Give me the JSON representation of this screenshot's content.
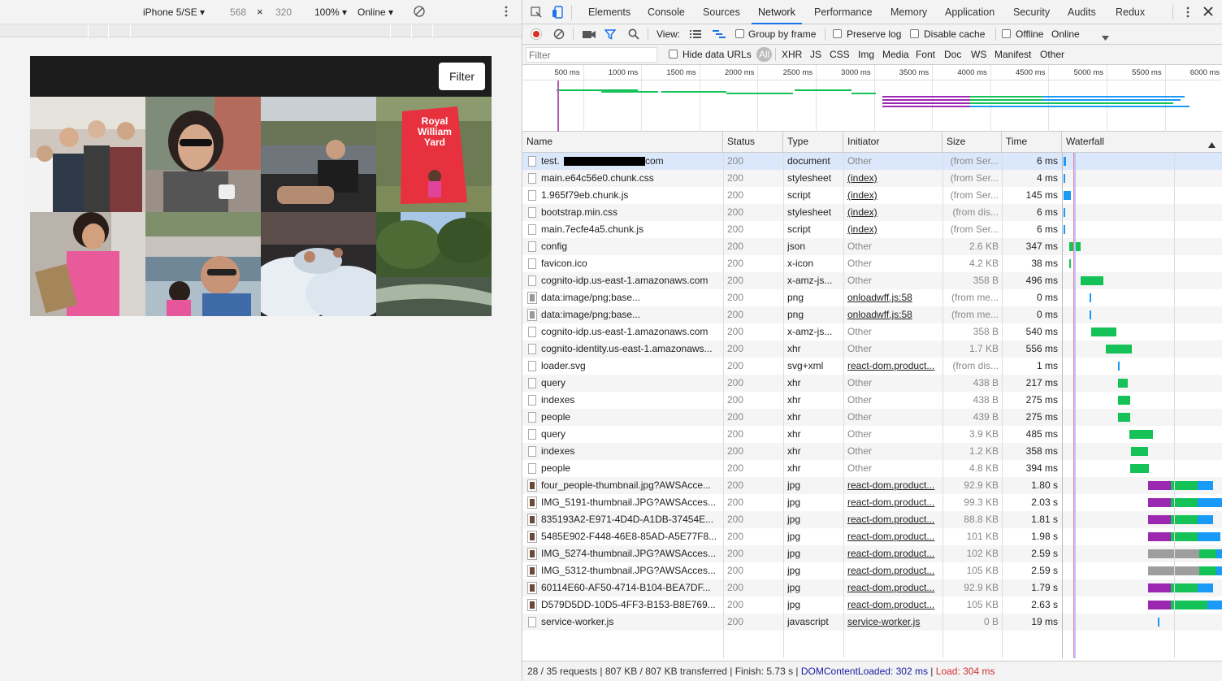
{
  "device_toolbar": {
    "device": "iPhone 5/SE ▾",
    "width": "568",
    "times": "×",
    "height": "320",
    "zoom": "100% ▾",
    "throttle": "Online ▾"
  },
  "app": {
    "filter_label": "Filter",
    "royal_sign": "Royal William Yard"
  },
  "devtools": {
    "tabs": [
      "Elements",
      "Console",
      "Sources",
      "Network",
      "Performance",
      "Memory",
      "Application",
      "Security",
      "Audits",
      "Redux"
    ],
    "active_tab": "Network",
    "toolbar": {
      "view_label": "View:",
      "group_by_frame": "Group by frame",
      "preserve_log": "Preserve log",
      "disable_cache": "Disable cache",
      "offline": "Offline",
      "online": "Online"
    },
    "filter": {
      "placeholder": "Filter",
      "hide_data_urls": "Hide data URLs",
      "types": [
        "All",
        "XHR",
        "JS",
        "CSS",
        "Img",
        "Media",
        "Font",
        "Doc",
        "WS",
        "Manifest",
        "Other"
      ]
    },
    "overview_ticks": [
      "500 ms",
      "1000 ms",
      "1500 ms",
      "2000 ms",
      "2500 ms",
      "3000 ms",
      "3500 ms",
      "4000 ms",
      "4500 ms",
      "5000 ms",
      "5500 ms",
      "6000 ms"
    ],
    "columns": [
      "Name",
      "Status",
      "Type",
      "Initiator",
      "Size",
      "Time",
      "Waterfall"
    ],
    "rows": [
      {
        "name": "test.",
        "name_suffix": "com",
        "status": "200",
        "type": "document",
        "initiator": "Other",
        "size": "(from Ser...",
        "time": "6 ms",
        "wf": [
          [
            0.0,
            0.8,
            "#1a9af7"
          ]
        ]
      },
      {
        "name": "main.e64c56e0.chunk.css",
        "status": "200",
        "type": "stylesheet",
        "initiator": "(index)",
        "size": "(from Ser...",
        "time": "4 ms",
        "wf": [
          [
            0.0,
            0.6,
            "#1a9af7"
          ]
        ]
      },
      {
        "name": "1.965f79eb.chunk.js",
        "status": "200",
        "type": "script",
        "initiator": "(index)",
        "size": "(from Ser...",
        "time": "145 ms",
        "wf": [
          [
            0.0,
            2.8,
            "#1a9af7"
          ]
        ]
      },
      {
        "name": "bootstrap.min.css",
        "status": "200",
        "type": "stylesheet",
        "initiator": "(index)",
        "size": "(from dis...",
        "time": "6 ms",
        "wf": [
          [
            0.0,
            0.6,
            "#1a9af7"
          ]
        ]
      },
      {
        "name": "main.7ecfe4a5.chunk.js",
        "status": "200",
        "type": "script",
        "initiator": "(index)",
        "size": "(from Ser...",
        "time": "6 ms",
        "wf": [
          [
            0.0,
            0.6,
            "#1a9af7"
          ]
        ]
      },
      {
        "name": "config",
        "status": "200",
        "type": "json",
        "initiator": "Other",
        "size": "2.6 KB",
        "time": "347 ms",
        "wf": [
          [
            2.1,
            6.4,
            "#14c257"
          ]
        ]
      },
      {
        "name": "favicon.ico",
        "status": "200",
        "type": "x-icon",
        "initiator": "Other",
        "size": "4.2 KB",
        "time": "38 ms",
        "wf": [
          [
            2.0,
            2.7,
            "#14c257"
          ]
        ]
      },
      {
        "name": "cognito-idp.us-east-1.amazonaws.com",
        "status": "200",
        "type": "x-amz-js...",
        "initiator": "Other",
        "size": "358 B",
        "time": "496 ms",
        "wf": [
          [
            6.4,
            15.0,
            "#14c257"
          ]
        ]
      },
      {
        "name": "data:image/png;base...",
        "status": "200",
        "type": "png",
        "initiator": "onloadwff.js:58",
        "size": "(from me...",
        "time": "0 ms",
        "wf": [
          [
            9.7,
            10.3,
            "#1a9af7"
          ]
        ]
      },
      {
        "name": "data:image/png;base...",
        "status": "200",
        "type": "png",
        "initiator": "onloadwff.js:58",
        "size": "(from me...",
        "time": "0 ms",
        "wf": [
          [
            9.7,
            10.3,
            "#1a9af7"
          ]
        ]
      },
      {
        "name": "cognito-idp.us-east-1.amazonaws.com",
        "status": "200",
        "type": "x-amz-js...",
        "initiator": "Other",
        "size": "358 B",
        "time": "540 ms",
        "wf": [
          [
            10.2,
            19.7,
            "#14c257"
          ]
        ]
      },
      {
        "name": "cognito-identity.us-east-1.amazonaws...",
        "status": "200",
        "type": "xhr",
        "initiator": "Other",
        "size": "1.7 KB",
        "time": "556 ms",
        "wf": [
          [
            15.7,
            25.5,
            "#14c257"
          ]
        ]
      },
      {
        "name": "loader.svg",
        "status": "200",
        "type": "svg+xml",
        "initiator": "react-dom.product...",
        "size": "(from dis...",
        "time": "1 ms",
        "wf": [
          [
            20.2,
            20.8,
            "#1a9af7"
          ]
        ]
      },
      {
        "name": "query",
        "status": "200",
        "type": "xhr",
        "initiator": "Other",
        "size": "438 B",
        "time": "217 ms",
        "wf": [
          [
            20.3,
            24.0,
            "#14c257"
          ]
        ]
      },
      {
        "name": "indexes",
        "status": "200",
        "type": "xhr",
        "initiator": "Other",
        "size": "438 B",
        "time": "275 ms",
        "wf": [
          [
            20.3,
            25.0,
            "#14c257"
          ]
        ]
      },
      {
        "name": "people",
        "status": "200",
        "type": "xhr",
        "initiator": "Other",
        "size": "439 B",
        "time": "275 ms",
        "wf": [
          [
            20.3,
            25.0,
            "#14c257"
          ]
        ]
      },
      {
        "name": "query",
        "status": "200",
        "type": "xhr",
        "initiator": "Other",
        "size": "3.9 KB",
        "time": "485 ms",
        "wf": [
          [
            24.5,
            33.3,
            "#14c257"
          ]
        ]
      },
      {
        "name": "indexes",
        "status": "200",
        "type": "xhr",
        "initiator": "Other",
        "size": "1.2 KB",
        "time": "358 ms",
        "wf": [
          [
            25.0,
            31.4,
            "#14c257"
          ]
        ]
      },
      {
        "name": "people",
        "status": "200",
        "type": "xhr",
        "initiator": "Other",
        "size": "4.8 KB",
        "time": "394 ms",
        "wf": [
          [
            24.8,
            31.8,
            "#14c257"
          ]
        ]
      },
      {
        "name": "four_people-thumbnail.jpg?AWSAcce...",
        "status": "200",
        "type": "jpg",
        "initiator": "react-dom.product...",
        "size": "92.9 KB",
        "time": "1.80 s",
        "wf": [
          [
            31.6,
            40.0,
            "#9c27b0"
          ],
          [
            40.0,
            50.0,
            "#14c257"
          ],
          [
            50.0,
            55.8,
            "#1a9af7"
          ]
        ]
      },
      {
        "name": "IMG_5191-thumbnail.JPG?AWSAcces...",
        "status": "200",
        "type": "jpg",
        "initiator": "react-dom.product...",
        "size": "99.3 KB",
        "time": "2.03 s",
        "wf": [
          [
            31.6,
            40.0,
            "#9c27b0"
          ],
          [
            40.0,
            50.0,
            "#14c257"
          ],
          [
            50.0,
            59.5,
            "#1a9af7"
          ]
        ]
      },
      {
        "name": "835193A2-E971-4D4D-A1DB-37454E...",
        "status": "200",
        "type": "jpg",
        "initiator": "react-dom.product...",
        "size": "88.8 KB",
        "time": "1.81 s",
        "wf": [
          [
            31.6,
            40.0,
            "#9c27b0"
          ],
          [
            40.0,
            50.0,
            "#14c257"
          ],
          [
            50.0,
            55.8,
            "#1a9af7"
          ]
        ]
      },
      {
        "name": "5485E902-F448-46E8-85AD-A5E77F8...",
        "status": "200",
        "type": "jpg",
        "initiator": "react-dom.product...",
        "size": "101 KB",
        "time": "1.98 s",
        "wf": [
          [
            31.6,
            40.0,
            "#9c27b0"
          ],
          [
            40.0,
            50.0,
            "#14c257"
          ],
          [
            50.0,
            58.5,
            "#1a9af7"
          ]
        ]
      },
      {
        "name": "IMG_5274-thumbnail.JPG?AWSAcces...",
        "status": "200",
        "type": "jpg",
        "initiator": "react-dom.product...",
        "size": "102 KB",
        "time": "2.59 s",
        "wf": [
          [
            31.6,
            50.5,
            "#9e9e9e"
          ],
          [
            50.5,
            57.0,
            "#14c257"
          ],
          [
            57.0,
            61.0,
            "#1a9af7"
          ]
        ]
      },
      {
        "name": "IMG_5312-thumbnail.JPG?AWSAcces...",
        "status": "200",
        "type": "jpg",
        "initiator": "react-dom.product...",
        "size": "105 KB",
        "time": "2.59 s",
        "wf": [
          [
            31.6,
            50.5,
            "#9e9e9e"
          ],
          [
            50.5,
            57.0,
            "#14c257"
          ],
          [
            57.0,
            61.0,
            "#1a9af7"
          ]
        ]
      },
      {
        "name": "60114E60-AF50-4714-B104-BEA7DF...",
        "status": "200",
        "type": "jpg",
        "initiator": "react-dom.product...",
        "size": "92.9 KB",
        "time": "1.79 s",
        "wf": [
          [
            31.6,
            40.0,
            "#9c27b0"
          ],
          [
            40.0,
            50.0,
            "#14c257"
          ],
          [
            50.0,
            55.8,
            "#1a9af7"
          ]
        ]
      },
      {
        "name": "D579D5DD-10D5-4FF3-B153-B8E769...",
        "status": "200",
        "type": "jpg",
        "initiator": "react-dom.product...",
        "size": "105 KB",
        "time": "2.63 s",
        "wf": [
          [
            31.6,
            40.0,
            "#9c27b0"
          ],
          [
            40.0,
            53.5,
            "#14c257"
          ],
          [
            53.5,
            61.0,
            "#1a9af7"
          ]
        ]
      },
      {
        "name": "service-worker.js",
        "status": "200",
        "type": "javascript",
        "initiator": "service-worker.js",
        "size": "0 B",
        "time": "19 ms",
        "wf": [
          [
            35.3,
            35.8,
            "#1a9af7"
          ]
        ]
      }
    ],
    "status_bar": {
      "summary": "28 / 35 requests | 807 KB / 807 KB transferred | Finish: 5.73 s | ",
      "dcl": "DOMContentLoaded: 302 ms",
      "sep": " | ",
      "load": "Load: 304 ms"
    }
  },
  "colors": {
    "accent": "#1a73e8",
    "dcl": "#1a1aa6",
    "load": "#d32f2f",
    "receiving": "#1a9af7",
    "waiting": "#14c257",
    "queued": "#9c27b0",
    "stalled": "#9e9e9e"
  }
}
